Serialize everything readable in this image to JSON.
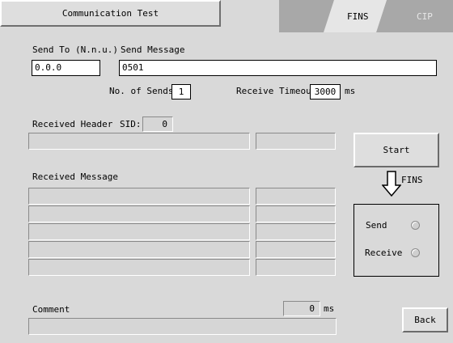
{
  "window": {
    "title_button": "Communication Test"
  },
  "tabs": [
    {
      "label": "FINS",
      "active": true
    },
    {
      "label": "CIP",
      "active": false
    }
  ],
  "send": {
    "send_to_label": "Send To (N.n.u.)",
    "send_to_value": "0.0.0",
    "send_message_label": "Send Message",
    "send_message_value": "0501"
  },
  "options": {
    "num_sends_label": "No. of Sends:",
    "num_sends_value": "1",
    "timeout_label": "Receive Timeout:",
    "timeout_value": "3000",
    "timeout_unit": "ms"
  },
  "received_header": {
    "label": "Received Header",
    "sid_label": "SID:",
    "sid_value": "0"
  },
  "received_message": {
    "label": "Received Message"
  },
  "comment": {
    "label": "Comment",
    "time_value": "0",
    "time_unit": "ms"
  },
  "controls": {
    "start_label": "Start",
    "protocol_label": "FINS",
    "send_status_label": "Send",
    "receive_status_label": "Receive",
    "back_label": "Back"
  },
  "colors": {
    "background": "#d9d9d9",
    "tab_active": "#e6e6e6",
    "tab_inactive": "#a8a8a8"
  }
}
